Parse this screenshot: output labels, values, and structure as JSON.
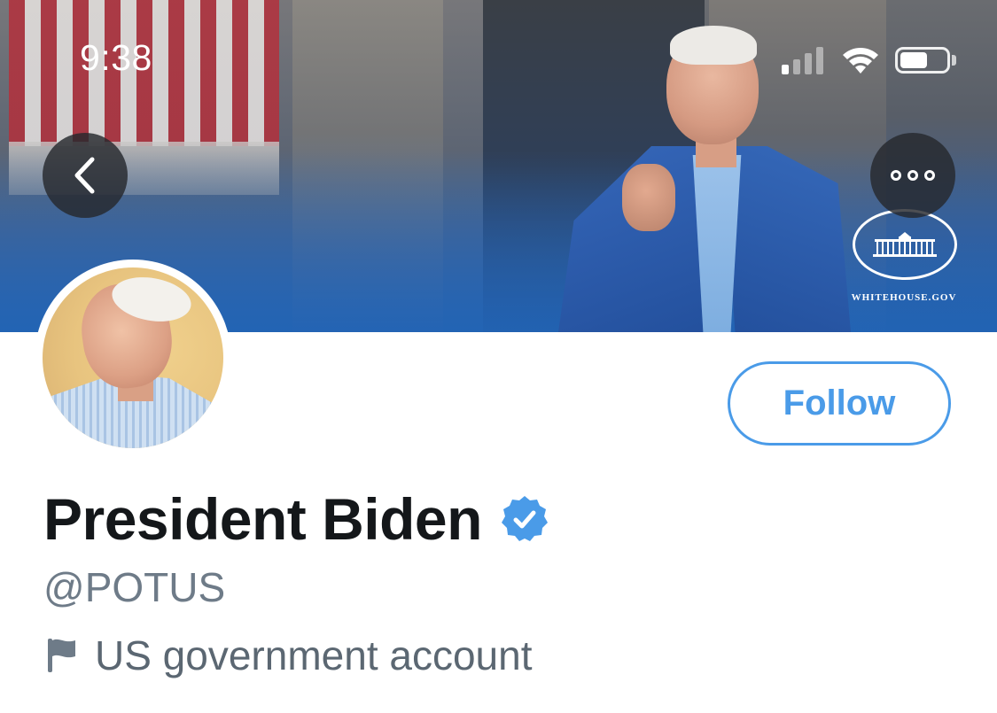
{
  "status_bar": {
    "time": "9:38",
    "signal_bars_active": 1,
    "signal_bars_total": 4,
    "battery_level": 0.6
  },
  "header": {
    "back_icon": "chevron-left-icon",
    "more_icon": "more-horizontal-icon",
    "banner_watermark": "WHITEHOUSE.GOV"
  },
  "profile": {
    "display_name": "President Biden",
    "verified": true,
    "handle": "@POTUS",
    "label_icon": "flag-icon",
    "label": "US government account",
    "follow_label": "Follow"
  },
  "colors": {
    "accent": "#4a9be8",
    "name": "#14171a",
    "secondary_text": "#6e7b88",
    "banner_blue": "#2763ad"
  }
}
